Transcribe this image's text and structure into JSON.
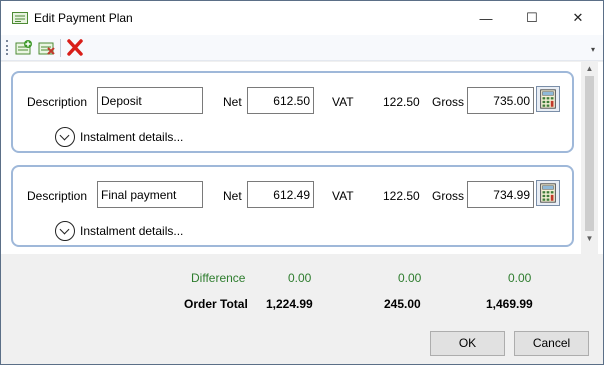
{
  "window": {
    "title": "Edit Payment Plan",
    "controls": {
      "minimize": "—",
      "maximize": "☐",
      "close": "✕"
    }
  },
  "toolbar": {
    "buttons": [
      "add-row-icon",
      "remove-row-icon",
      "delete-icon"
    ],
    "overflow": "▾"
  },
  "scrollbar": {
    "up": "▲",
    "down": "▼"
  },
  "instalments": [
    {
      "description_label": "Description",
      "description": "Deposit",
      "net_label": "Net",
      "net": "612.50",
      "vat_label": "VAT",
      "vat": "122.50",
      "gross_label": "Gross",
      "gross": "735.00",
      "details_label": "Instalment details..."
    },
    {
      "description_label": "Description",
      "description": "Final payment",
      "net_label": "Net",
      "net": "612.49",
      "vat_label": "VAT",
      "vat": "122.50",
      "gross_label": "Gross",
      "gross": "734.99",
      "details_label": "Instalment details..."
    }
  ],
  "summary": {
    "difference": {
      "label": "Difference",
      "net": "0.00",
      "vat": "0.00",
      "gross": "0.00",
      "color": "#2e7d2e"
    },
    "order_total": {
      "label": "Order Total",
      "net": "1,224.99",
      "vat": "245.00",
      "gross": "1,469.99"
    }
  },
  "buttons": {
    "ok": "OK",
    "cancel": "Cancel"
  }
}
